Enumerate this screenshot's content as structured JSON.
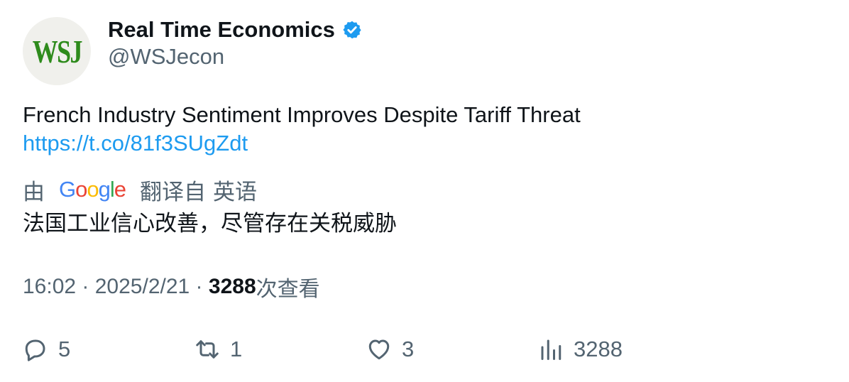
{
  "author": {
    "avatar_text": "WSJ",
    "display_name": "Real Time Economics",
    "handle": "@WSJecon",
    "verified": true
  },
  "tweet": {
    "text": "French Industry Sentiment Improves Despite Tariff Threat",
    "link": "https://t.co/81f3SUgZdt"
  },
  "translation": {
    "by_label": "由",
    "provider": "Google",
    "from_label": "翻译自",
    "language": "英语",
    "text": "法国工业信心改善，尽管存在关税威胁"
  },
  "meta": {
    "time": "16:02",
    "separator": " · ",
    "date": "2025/2/21",
    "views_count": "3288",
    "views_label": "次查看"
  },
  "actions": {
    "replies": "5",
    "retweets": "1",
    "likes": "3",
    "views": "3288"
  },
  "colors": {
    "text": "#0f1419",
    "secondary": "#536471",
    "link": "#1d9bf0",
    "verified": "#1d9bf0",
    "wsj_green": "#2e8b1c"
  }
}
